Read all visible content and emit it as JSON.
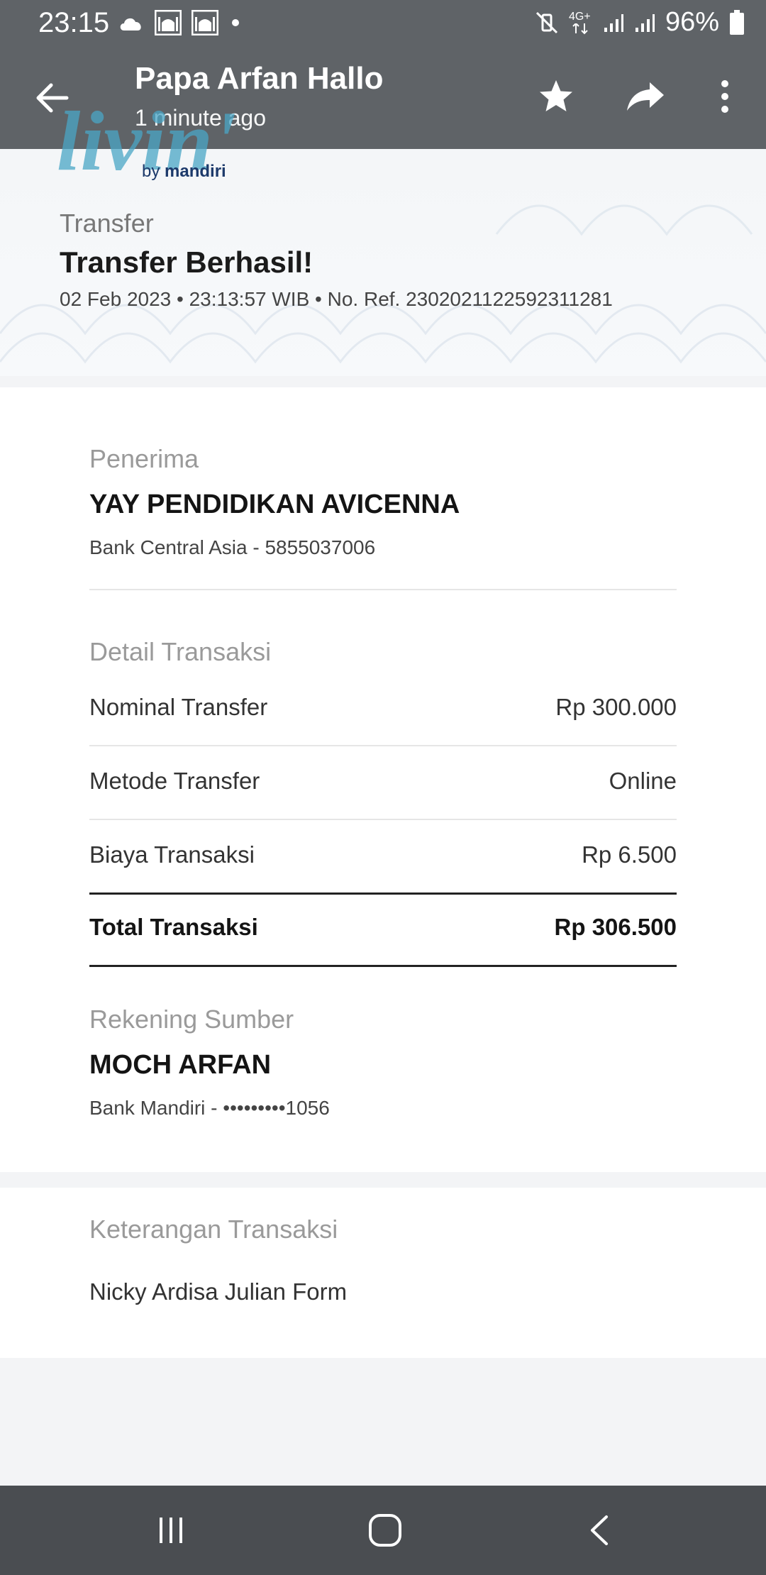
{
  "status_bar": {
    "time": "23:15",
    "battery": "96%",
    "left_icons": [
      "cloud-icon",
      "mosque-icon",
      "mosque-icon",
      "dot-icon"
    ],
    "right_icons": [
      "mute-vibrate-icon",
      "4g-icon",
      "signal-icon",
      "signal-icon",
      "battery-icon"
    ],
    "network_label": "4G+"
  },
  "app_bar": {
    "title": "Papa Arfan Hallo",
    "subtitle": "1 minute ago",
    "icons": [
      "back-arrow-icon",
      "star-icon",
      "share-icon",
      "more-vert-icon"
    ]
  },
  "receipt": {
    "brand": {
      "logo": "livin'",
      "by": "by",
      "name": "mandiri"
    },
    "type": "Transfer",
    "status": "Transfer Berhasil!",
    "meta": "02 Feb 2023 • 23:13:57 WIB • No. Ref. 2302021122592311281",
    "recipient": {
      "label": "Penerima",
      "name": "YAY PENDIDIKAN AVICENNA",
      "bank": "Bank Central Asia - 5855037006"
    },
    "details": {
      "label": "Detail Transaksi",
      "rows": [
        {
          "label": "Nominal Transfer",
          "value": "Rp 300.000"
        },
        {
          "label": "Metode Transfer",
          "value": "Online"
        },
        {
          "label": "Biaya Transaksi",
          "value": "Rp 6.500"
        }
      ],
      "total": {
        "label": "Total Transaksi",
        "value": "Rp 306.500"
      }
    },
    "source": {
      "label": "Rekening Sumber",
      "name": "MOCH ARFAN",
      "bank": "Bank Mandiri - •••••••••1056"
    },
    "note": {
      "label": "Keterangan Transaksi",
      "text": "Nicky Ardisa Julian Form"
    }
  },
  "nav_bar": {
    "icons": [
      "recent-apps-icon",
      "home-icon",
      "back-icon"
    ]
  },
  "colors": {
    "appbar": "#5f6367",
    "navbar": "#4a4d51",
    "logo": "#4aa6c6"
  }
}
